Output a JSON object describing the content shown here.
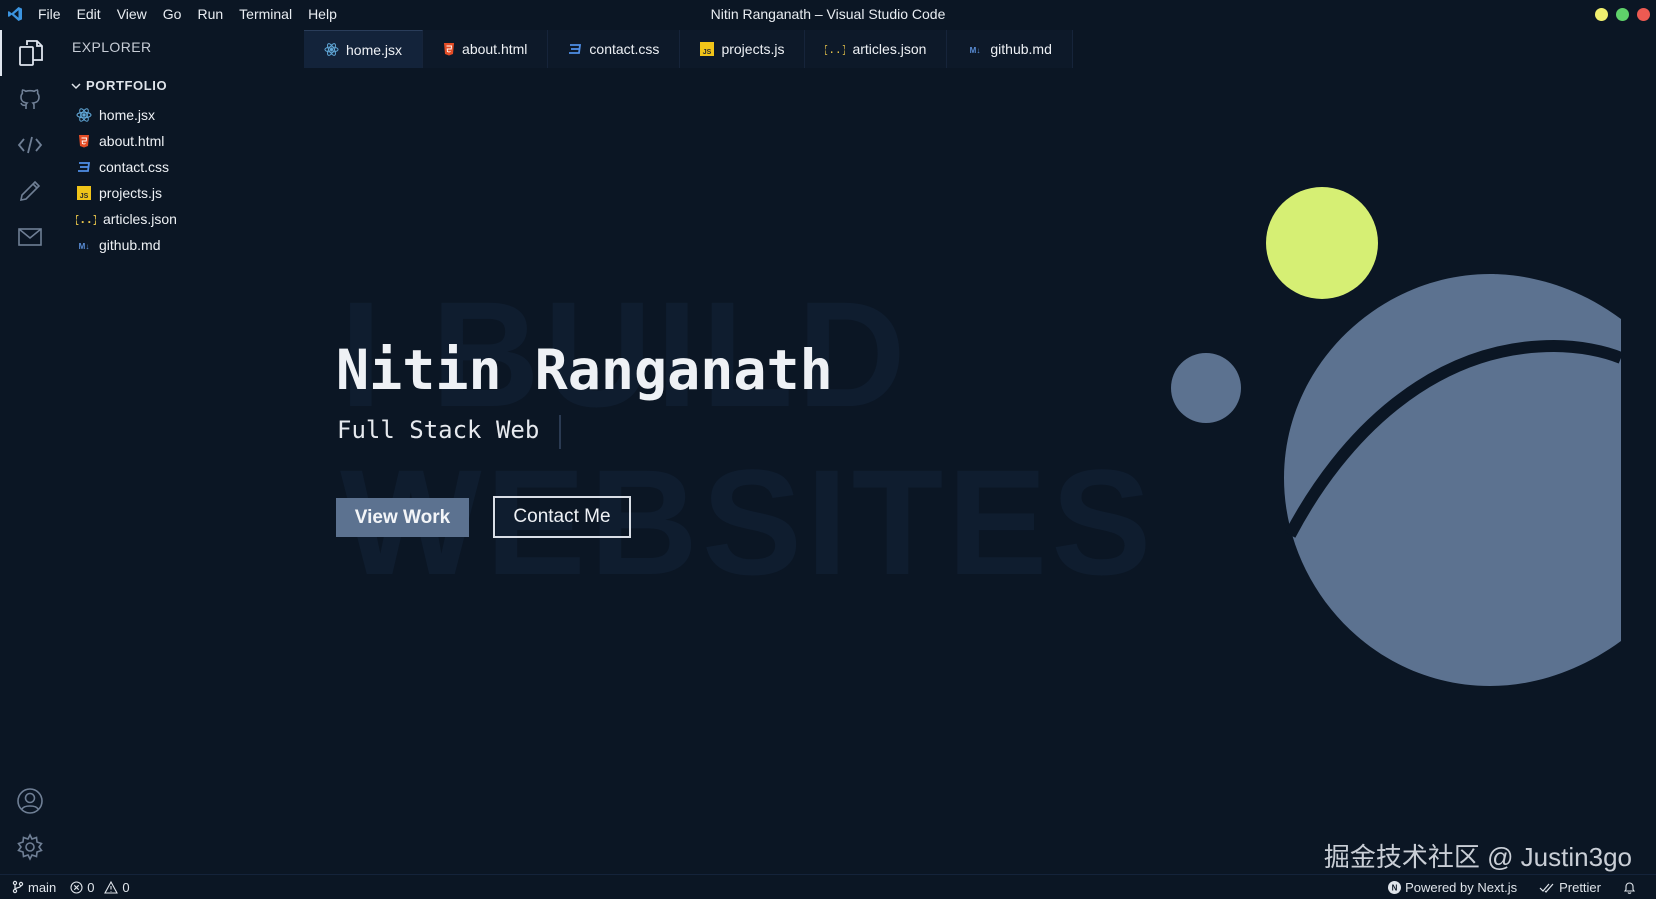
{
  "window": {
    "title": "Nitin Ranganath – Visual Studio Code",
    "traffic_colors": [
      "#f0ef6f",
      "#5fd16a",
      "#ec5a52"
    ]
  },
  "menu": [
    "File",
    "Edit",
    "View",
    "Go",
    "Run",
    "Terminal",
    "Help"
  ],
  "activity_bar": {
    "top": [
      "files-icon",
      "github-icon",
      "code-icon",
      "pencil-icon",
      "mail-icon"
    ],
    "bottom": [
      "account-icon",
      "settings-gear-icon"
    ]
  },
  "sidebar": {
    "title": "EXPLORER",
    "folder": "PORTFOLIO",
    "files": [
      {
        "name": "home.jsx",
        "icon": "react-icon",
        "color": "#61a8d8"
      },
      {
        "name": "about.html",
        "icon": "html-icon",
        "color": "#e44d26"
      },
      {
        "name": "contact.css",
        "icon": "css-icon",
        "color": "#4f8ee6"
      },
      {
        "name": "projects.js",
        "icon": "js-icon",
        "color": "#f0c419"
      },
      {
        "name": "articles.json",
        "icon": "json-icon",
        "color": "#e6c34a"
      },
      {
        "name": "github.md",
        "icon": "markdown-icon",
        "color": "#5b8fd9"
      }
    ]
  },
  "tabs": [
    {
      "label": "home.jsx",
      "active": true
    },
    {
      "label": "about.html",
      "active": false
    },
    {
      "label": "contact.css",
      "active": false
    },
    {
      "label": "projects.js",
      "active": false
    },
    {
      "label": "articles.json",
      "active": false
    },
    {
      "label": "github.md",
      "active": false
    }
  ],
  "hero": {
    "bg_line1": "I BUILD",
    "bg_line2": "WEBSITES",
    "name": "Nitin Ranganath",
    "subtitle": "Full Stack Web",
    "primary_button": "View Work",
    "secondary_button": "Contact Me"
  },
  "colors": {
    "background": "#0b1624",
    "accent_circle": "#d6ef74",
    "slate": "#5c7290"
  },
  "watermark": "掘金技术社区 @ Justin3go",
  "statusbar": {
    "branch": "main",
    "errors": "0",
    "warnings": "0",
    "powered_by": "Powered by Next.js",
    "prettier": "Prettier"
  }
}
